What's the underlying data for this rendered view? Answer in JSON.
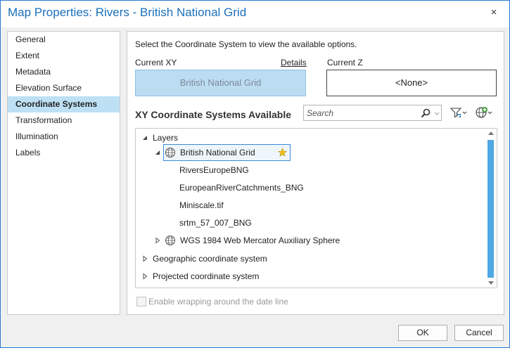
{
  "window": {
    "title": "Map Properties: Rivers - British National Grid",
    "close_icon": "×"
  },
  "sidebar": {
    "items": [
      {
        "label": "General",
        "selected": false
      },
      {
        "label": "Extent",
        "selected": false
      },
      {
        "label": "Metadata",
        "selected": false
      },
      {
        "label": "Elevation Surface",
        "selected": false
      },
      {
        "label": "Coordinate Systems",
        "selected": true
      },
      {
        "label": "Transformation",
        "selected": false
      },
      {
        "label": "Illumination",
        "selected": false
      },
      {
        "label": "Labels",
        "selected": false
      }
    ]
  },
  "main": {
    "instruction": "Select the Coordinate System to view the available options.",
    "current_xy_label": "Current XY",
    "details_link": "Details",
    "current_z_label": "Current Z",
    "current_xy_value": "British National Grid",
    "current_z_value": "<None>",
    "section_heading": "XY Coordinate Systems Available",
    "search_placeholder": "Search"
  },
  "tree": {
    "layers_label": "Layers",
    "selected_system": "British National Grid",
    "children": [
      "RiversEuropeBNG",
      "EuropeanRiverCatchments_BNG",
      "Miniscale.tif",
      "srtm_57_007_BNG"
    ],
    "other_system": "WGS 1984 Web Mercator Auxiliary Sphere",
    "geographic": "Geographic coordinate system",
    "projected": "Projected coordinate system"
  },
  "options": {
    "wrap_label": "Enable wrapping around the date line",
    "wrap_checked": false
  },
  "footer": {
    "ok_label": "OK",
    "cancel_label": "Cancel"
  },
  "colors": {
    "accent": "#1a6fba",
    "selection": "#bde0f4",
    "scroll_thumb": "#4fa8e3"
  }
}
